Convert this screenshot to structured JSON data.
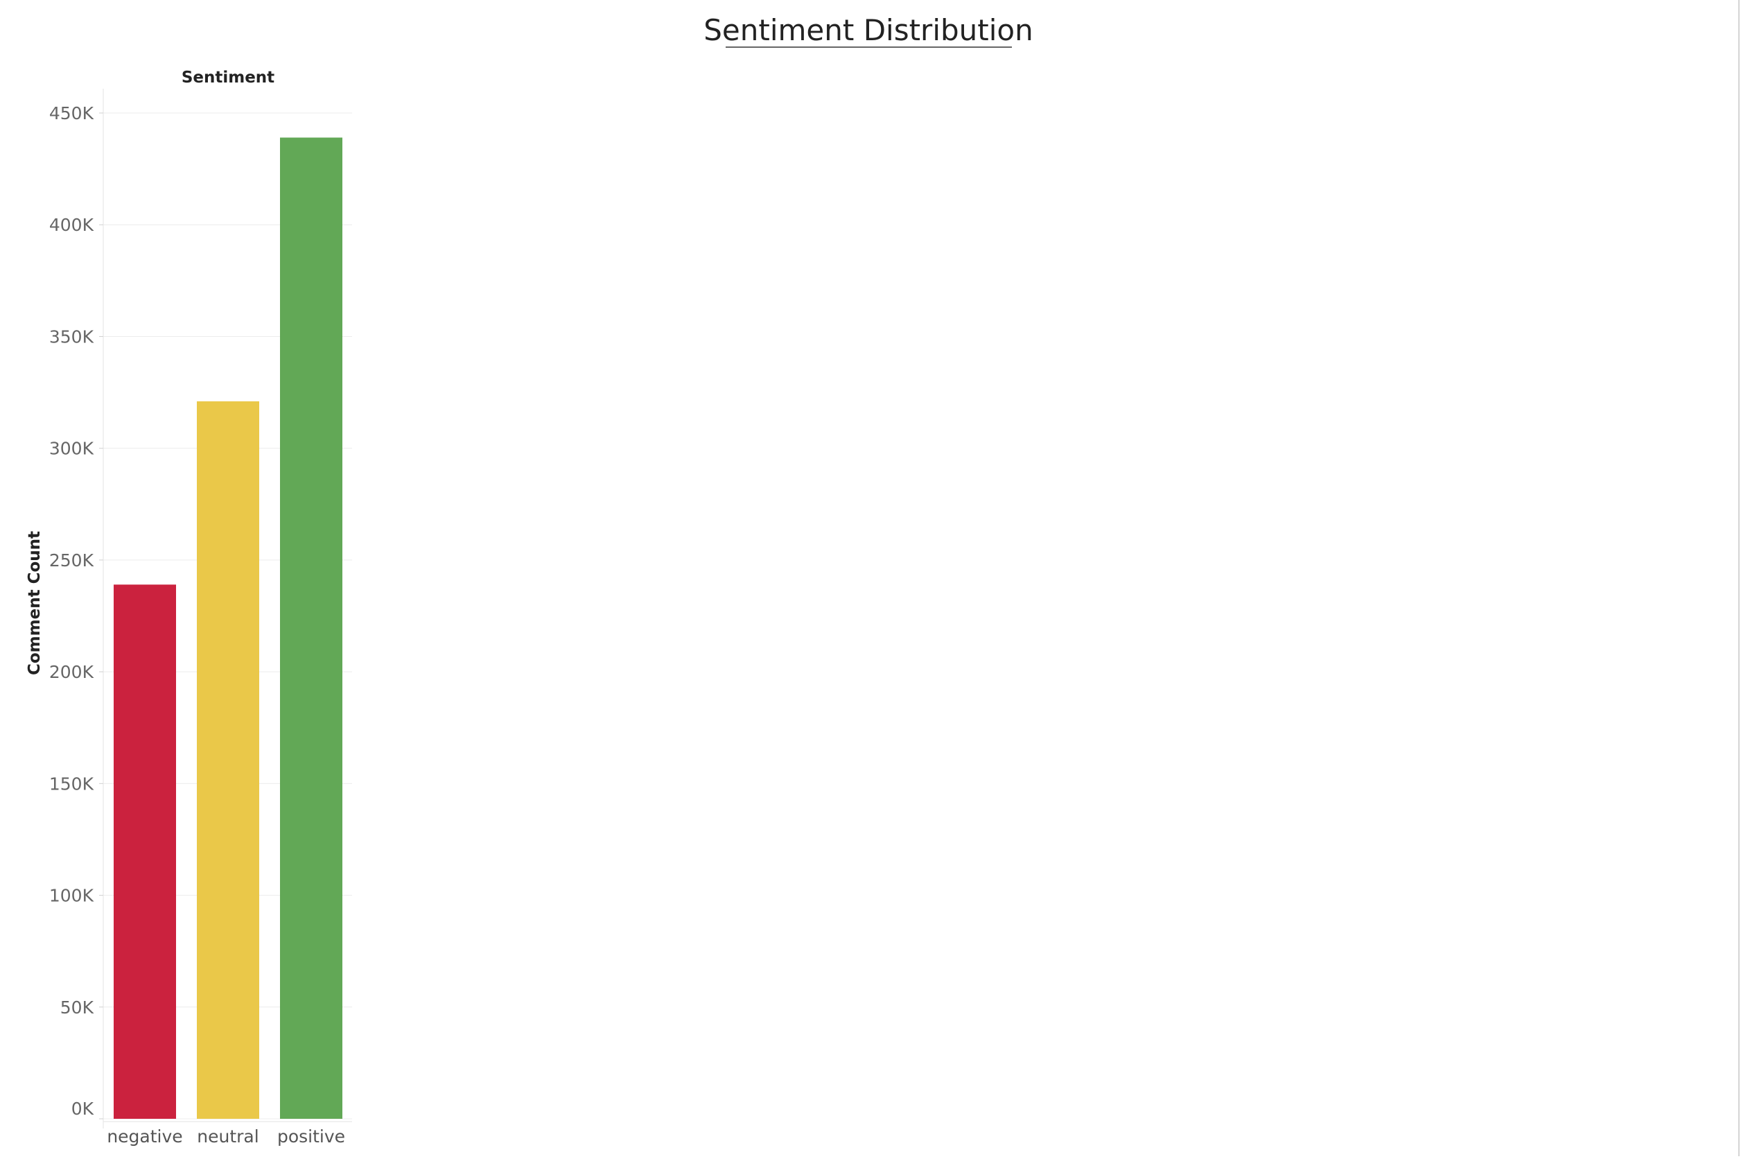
{
  "chart_data": {
    "type": "bar",
    "title": "Sentiment Distribution",
    "column_header": "Sentiment",
    "xlabel": "",
    "ylabel": "Comment Count",
    "categories": [
      "negative",
      "neutral",
      "positive"
    ],
    "values": [
      239000,
      321000,
      439000
    ],
    "colors": [
      "#cb223e",
      "#eac849",
      "#62a856"
    ],
    "ylim": [
      0,
      450000
    ],
    "yticks": [
      0,
      50000,
      100000,
      150000,
      200000,
      250000,
      300000,
      350000,
      400000,
      450000
    ],
    "ytick_labels": [
      "0K",
      "50K",
      "100K",
      "150K",
      "200K",
      "250K",
      "300K",
      "350K",
      "400K",
      "450K"
    ],
    "grid": true,
    "legend": "none"
  }
}
